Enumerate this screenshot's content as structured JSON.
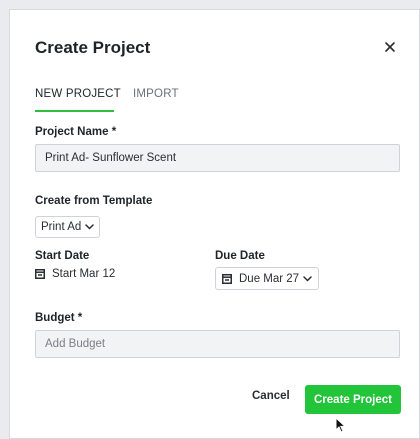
{
  "dialog": {
    "title": "Create Project",
    "close_icon": "close-icon"
  },
  "tabs": [
    {
      "label": "NEW PROJECT",
      "active": true
    },
    {
      "label": "IMPORT",
      "active": false
    }
  ],
  "form": {
    "project_name": {
      "label": "Project Name *",
      "value": "Print Ad- Sunflower Scent"
    },
    "template": {
      "label": "Create from Template",
      "selected": "Print Ad"
    },
    "start_date": {
      "label": "Start Date",
      "value": "Start Mar 12",
      "icon": "calendar-start-icon"
    },
    "due_date": {
      "label": "Due Date",
      "value": "Due Mar 27",
      "icon": "calendar-end-icon"
    },
    "budget": {
      "label": "Budget *",
      "placeholder": "Add Budget"
    }
  },
  "actions": {
    "cancel": "Cancel",
    "create": "Create Project"
  },
  "colors": {
    "accent": "#22c43a",
    "tab_underline": "#2fbf3e"
  }
}
